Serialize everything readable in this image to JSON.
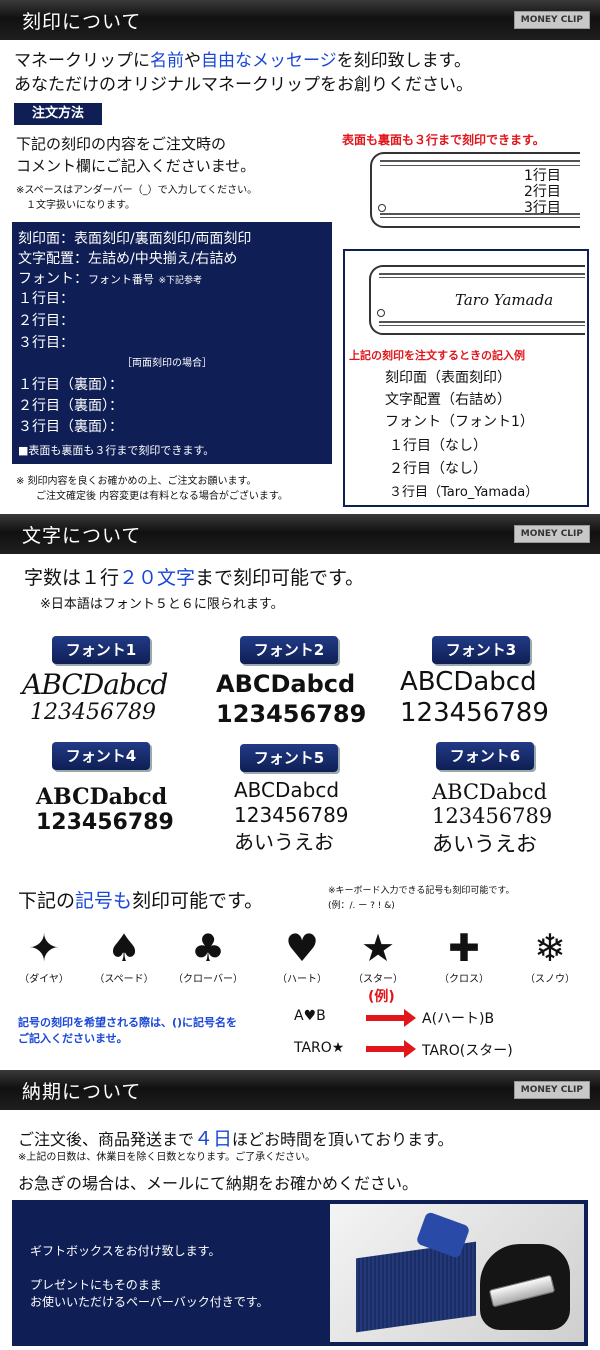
{
  "s1": {
    "title": "刻印について",
    "badge": "MONEY CLIP",
    "intro1_a": "マネークリップに",
    "intro1_name": "名前",
    "intro1_b": "や",
    "intro1_free": "自由なメッセージ",
    "intro1_c": "を刻印致します。",
    "intro2": "あなただけのオリジナルマネークリップをお創りください。",
    "order_label": "注文方法",
    "order1": "下記の刻印の内容をご注文時の",
    "order2": "コメント欄にご記入くださいませ。",
    "note1": "※スペースはアンダーバー（_）で入力してください。",
    "note2": "　１文字扱いになります。",
    "box": {
      "l1": "刻印面：表面刻印/裏面刻印/両面刻印",
      "l2": "文字配置：左詰め/中央揃え/右詰め",
      "l3a": "フォント：",
      "l3b": "フォント番号",
      "l3c": "※下記参考",
      "l4": "１行目：",
      "l5": "２行目：",
      "l6": "３行目：",
      "l7": "［両面刻印の場合］",
      "l8": "１行目（裏面）：",
      "l9": "２行目（裏面）：",
      "l10": "３行目（裏面）：",
      "l11": "■表面も裏面も３行まで刻印できます。"
    },
    "foot1": "※ 刻印内容を良くお確かめの上、ご注文お願います。",
    "foot2": "ご注文確定後 内容変更は有料となる場合がございます。",
    "right_head": "表面も裏面も３行まで刻印できます。",
    "clip_lines": [
      "1行目",
      "2行目",
      "3行目"
    ],
    "example": {
      "clip_text": "Taro Yamada",
      "head": "上記の刻印を注文するときの記入例",
      "lines": [
        "刻印面（表面刻印）",
        "文字配置（右詰め）",
        "フォント（フォント1）",
        "１行目（なし）",
        "２行目（なし）",
        "３行目（Taro_Yamada）"
      ]
    }
  },
  "s2": {
    "title": "文字について",
    "badge": "MONEY CLIP",
    "count_a": "字数は１行",
    "count_b": "２０文字",
    "count_c": "まで刻印可能です。",
    "jp_note": "※日本語はフォント５と６に限られます。",
    "fonts": [
      {
        "label": "フォント1",
        "s1": "ABCDabcd",
        "s2": "123456789"
      },
      {
        "label": "フォント2",
        "s1": "ABCDabcd",
        "s2": "123456789"
      },
      {
        "label": "フォント3",
        "s1": "ABCDabcd",
        "s2": "123456789"
      },
      {
        "label": "フォント4",
        "s1": "ABCDabcd",
        "s2": "123456789"
      },
      {
        "label": "フォント5",
        "s1": "ABCDabcd",
        "s2": "123456789",
        "s3": "あいうえお"
      },
      {
        "label": "フォント6",
        "s1": "ABCDabcd",
        "s2": "123456789",
        "s3": "あいうえお"
      }
    ],
    "sym_a": "下記の",
    "sym_b": "記号も",
    "sym_c": "刻印可能です。",
    "sym_note1": "※キーボード入力できる記号も刻印可能です。",
    "sym_note2": "(例：/. ー ? ! &)",
    "symbols": [
      {
        "glyph": "✦",
        "label": "（ダイヤ）"
      },
      {
        "glyph": "♠",
        "label": "（スペード）"
      },
      {
        "glyph": "♣",
        "label": "（クローバー）"
      },
      {
        "glyph": "♥",
        "label": "（ハート）"
      },
      {
        "glyph": "★",
        "label": "（スター）"
      },
      {
        "glyph": "✚",
        "label": "（クロス）"
      },
      {
        "glyph": "❄",
        "label": "（スノウ）"
      }
    ],
    "example_label": "(例)",
    "inst1": "記号の刻印を希望される際は、()に記号名を",
    "inst2": "ご記入くださいませ。",
    "ex1_in": "A♥B",
    "ex1_out": "A(ハート)B",
    "ex2_in": "TARO★",
    "ex2_out": "TARO(スター)"
  },
  "s3": {
    "title": "納期について",
    "badge": "MONEY CLIP",
    "d1a": "ご注文後、商品発送まで",
    "d1b": "４日",
    "d1c": "ほどお時間を頂いております。",
    "d2": "※上記の日数は、休業日を除く日数となります。ご了承ください。",
    "d3": "お急ぎの場合は、メールにて納期をお確かめください。",
    "gift1": "ギフトボックスをお付け致します。",
    "gift2": "プレゼントにもそのまま",
    "gift3": "お使いいただけるペーパーバック付きです。"
  },
  "colors": {
    "navy": "#0f1f55",
    "red": "#e0161b",
    "blue": "#1a47d8"
  }
}
